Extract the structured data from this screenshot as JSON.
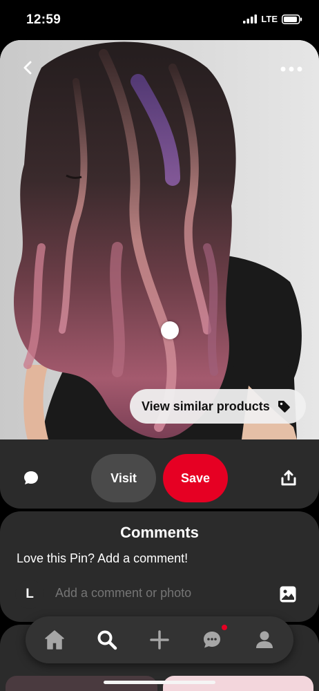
{
  "status_bar": {
    "time": "12:59",
    "network": "LTE",
    "icons": [
      "signal-bars-icon",
      "battery-icon"
    ]
  },
  "pin": {
    "image_description_icon": "hair-photo",
    "similar_products_label": "View similar products",
    "similar_icon": "tag-icon"
  },
  "actions": {
    "visit_label": "Visit",
    "save_label": "Save",
    "save_color": "#e60023",
    "visit_color": "#4a4a4a"
  },
  "comments": {
    "title": "Comments",
    "prompt": "Love this Pin? Add a comment!",
    "avatar_initial": "L",
    "input_placeholder": "Add a comment or photo"
  },
  "nav": {
    "items": [
      "home-icon",
      "search-icon",
      "plus-icon",
      "messages-icon",
      "profile-icon"
    ],
    "has_message_notification": true
  }
}
